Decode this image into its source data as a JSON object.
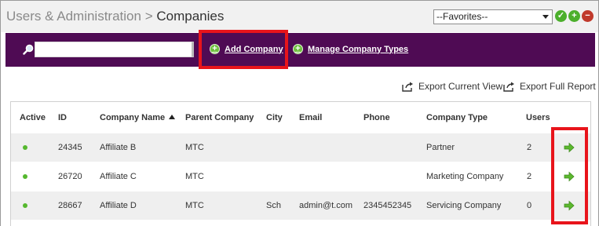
{
  "breadcrumb": {
    "parent": "Users & Administration",
    "separator": ">",
    "current": "Companies"
  },
  "favorites": {
    "selected": "--Favorites--"
  },
  "header_icons": [
    "check-icon",
    "plus-icon",
    "minus-icon"
  ],
  "toolbar": {
    "search_value": "",
    "add_company": "Add Company",
    "manage_types": "Manage Company Types"
  },
  "export": {
    "current_view": "Export Current View",
    "full_report": "Export Full Report"
  },
  "table": {
    "columns": [
      "Active",
      "ID",
      "Company Name",
      "Parent Company",
      "City",
      "Email",
      "Phone",
      "Company Type",
      "Users"
    ],
    "sorted_column": "Company Name",
    "rows": [
      {
        "active": true,
        "id": "24345",
        "company_name": "Affiliate B",
        "parent": "MTC",
        "city": "",
        "email": "",
        "phone": "",
        "type": "Partner",
        "users": "2"
      },
      {
        "active": true,
        "id": "26720",
        "company_name": "Affiliate C",
        "parent": "MTC",
        "city": "",
        "email": "",
        "phone": "",
        "type": "Marketing Company",
        "users": "2"
      },
      {
        "active": true,
        "id": "28667",
        "company_name": "Affiliate D",
        "parent": "MTC",
        "city": "Sch",
        "email": "admin@t.com",
        "phone": "2345452345",
        "type": "Servicing Company",
        "users": "0"
      }
    ]
  },
  "colors": {
    "toolbar_bg": "#4f0b54",
    "highlight": "#e8141b",
    "accent_green": "#4caf2c"
  }
}
